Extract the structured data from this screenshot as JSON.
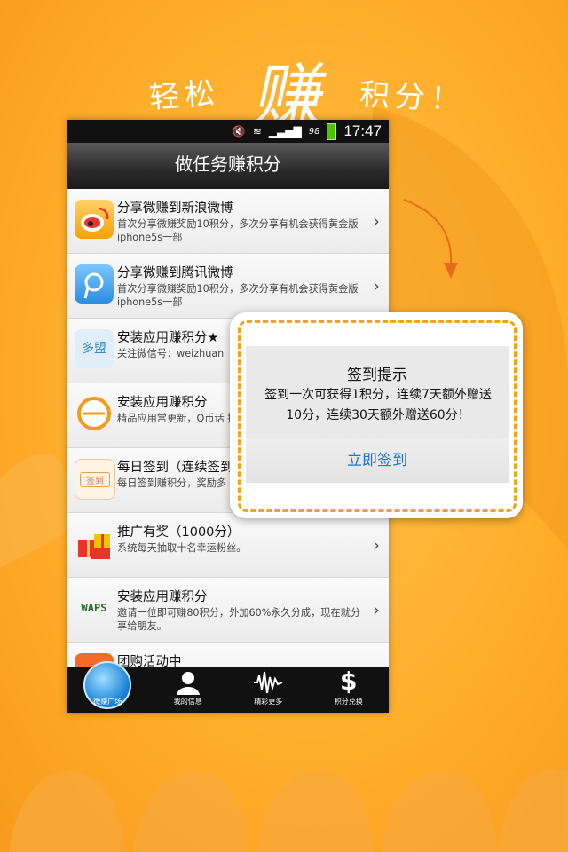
{
  "headline": {
    "left": "轻松",
    "mid": "赚",
    "right": "积分！"
  },
  "statusbar": {
    "battery": "98",
    "time": "17:47"
  },
  "title": "做任务赚积分",
  "rows": [
    {
      "title": "分享微赚到新浪微博",
      "desc": "首次分享微赚奖励10积分，多次分享有机会获得黄金版iphone5s一部",
      "icon": "weibo-icon"
    },
    {
      "title": "分享微赚到腾讯微博",
      "desc": "首次分享微赚奖励10积分，多次分享有机会获得黄金版iphone5s一部",
      "icon": "tencent-weibo-icon"
    },
    {
      "title": "安装应用赚积分★",
      "desc": "关注微信号：weizhuan",
      "icon": "duomeng-icon",
      "icon_text": "多盟"
    },
    {
      "title": "安装应用赚积分",
      "desc": "精品应用常更新，Q币话 换。",
      "icon": "app-icon"
    },
    {
      "title": "每日签到（连续签到",
      "desc": "每日签到赚积分，奖励多",
      "icon": "signin-icon",
      "icon_text": "签到"
    },
    {
      "title": "推广有奖（1000分）",
      "desc": "系统每天抽取十名幸运粉丝。",
      "icon": "gift-icon"
    },
    {
      "title": "安装应用赚积分",
      "desc": "邀请一位即可赚80积分，外加60%永久分成，现在就分享给朋友。",
      "icon": "waps-icon",
      "icon_text": "WAPS"
    },
    {
      "title": "团购活动中",
      "desc": "",
      "icon": "group-buy-icon"
    }
  ],
  "tabs": [
    {
      "label": "微赚广场",
      "icon": "globe-icon",
      "active": true
    },
    {
      "label": "我的信息",
      "icon": "user-icon",
      "active": false
    },
    {
      "label": "精彩更多",
      "icon": "waveform-icon",
      "active": false
    },
    {
      "label": "积分兑换",
      "icon": "dollar-icon",
      "active": false,
      "glyph": "$"
    }
  ],
  "dialog": {
    "title": "签到提示",
    "message": "签到一次可获得1积分，连续7天额外赠送10分，连续30天额外赠送60分！",
    "button": "立即签到"
  },
  "colors": {
    "accent": "#f5a21b",
    "link": "#1e74c8",
    "background": "#ffae2c"
  }
}
